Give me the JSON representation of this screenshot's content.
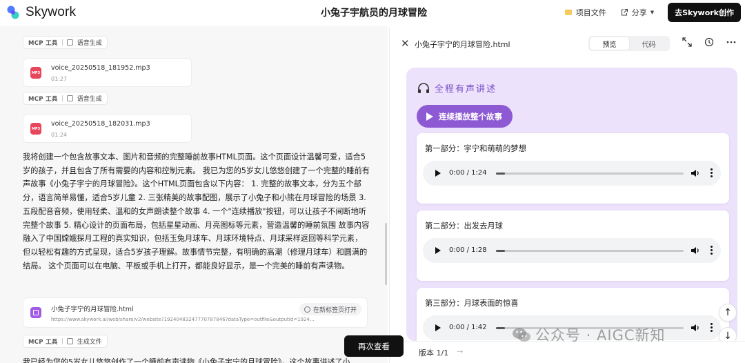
{
  "app": {
    "brand": "Skywork",
    "doc_title": "小兔子宇航员的月球冒险",
    "project_files": "项目文件",
    "share": "分享",
    "create_button": "去Skywork创作"
  },
  "chat": {
    "chips": [
      {
        "tool": "MCP 工具",
        "action": "语音生成"
      },
      {
        "tool": "MCP 工具",
        "action": "语音生成"
      },
      {
        "tool": "MCP 工具",
        "action": "生成文件"
      }
    ],
    "audio_files": [
      {
        "name": "voice_20250518_181952.mp3",
        "duration": "01:27",
        "badge": "MP3"
      },
      {
        "name": "voice_20250518_182031.mp3",
        "duration": "01:24",
        "badge": "MP3"
      }
    ],
    "message": "我将创建一个包含故事文本、图片和音频的完整睡前故事HTML页面。这个页面设计温馨可爱，适合5岁的孩子，并且包含了所有需要的内容和控制元素。 我已为您的5岁女儿悠悠创建了一个完整的睡前有声故事《小兔子宇宁的月球冒险》。这个HTML页面包含以下内容： 1. 完整的故事文本，分为五个部分，语言简单易懂，适合5岁儿童 2. 三张精美的故事配图，展示了小兔子和小熊在月球冒险的场景 3. 五段配音音频，使用轻柔、温和的女声朗读整个故事 4. 一个\"连续播放\"按钮，可以让孩子不间断地听完整个故事 5. 精心设计的页面布局，包括星星动画、月亮图标等元素，营造温馨的睡前氛围 故事内容融入了中国嫦娥探月工程的真实知识，包括玉兔月球车、月球环境特点、月球采样返回等科学元素，但以轻松有趣的方式呈现，适合5岁孩子理解。故事情节完整，有明确的高潮（修理月球车）和圆满的结局。 这个页面可以在电脑、平板或手机上打开，都能良好显示，是一个完美的睡前有声读物。",
    "file_card": {
      "title": "小兔子宇宁的月球冒险.html",
      "url": "https://www.skywork.ai/web/share/v2/website?19240483247770787846?dataType=outfile&outputId=1924...",
      "open_label": "在新标签页打开"
    },
    "trailing_text": "我已经为您的5岁女儿悠悠创作了一个睡前有声读物《小兔子宇宁的月球冒险》，这个故事讲述了小",
    "recheck_button": "再次查看"
  },
  "preview": {
    "file_name": "小兔子宇宁的月球冒险.html",
    "tabs": [
      "预览",
      "代码"
    ],
    "active_tab": "预览",
    "section_title": "全程有声讲述",
    "play_all_button": "连续播放整个故事",
    "parts": [
      {
        "title": "第一部分：宇宁和萌萌的梦想",
        "time": "0:00 / 1:24"
      },
      {
        "title": "第二部分：出发去月球",
        "time": "0:00 / 1:28"
      },
      {
        "title": "第三部分：月球表面的惊喜",
        "time": "0:00 / 1:42"
      }
    ],
    "version": "版本 1/1"
  },
  "watermark": "公众号 · AIGC新知",
  "colors": {
    "accent_purple": "#8d5ad3",
    "stage_bg": "#ede2fb",
    "mp3_red": "#e8465b",
    "dark_button": "#111111"
  }
}
